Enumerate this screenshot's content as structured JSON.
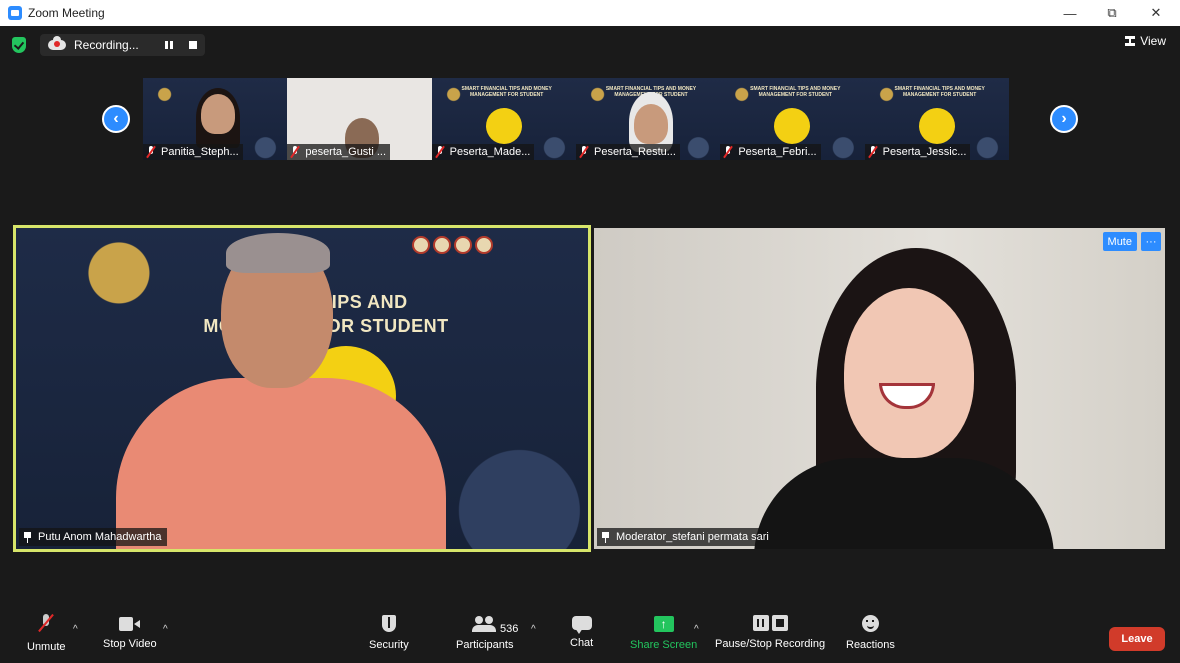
{
  "window": {
    "title": "Zoom Meeting",
    "minimize": "—",
    "restore": "⧉",
    "close": "✕"
  },
  "topbar": {
    "recording_label": "Recording...",
    "view_label": "View"
  },
  "nav": {
    "prev": "‹",
    "next": "›"
  },
  "thumbnails": [
    {
      "name": "Panitia_Steph..."
    },
    {
      "name": "peserta_Gusti ..."
    },
    {
      "name": "Peserta_Made..."
    },
    {
      "name": "Peserta_Restu..."
    },
    {
      "name": "Peserta_Febri..."
    },
    {
      "name": "Peserta_Jessic..."
    }
  ],
  "thumb_header_text": "SMART FINANCIAL TIPS AND MONEY MANAGEMENT FOR STUDENT",
  "speaker": {
    "name": "Putu Anom Mahadwartha",
    "slide_title_line1": "SMA        AL TIPS AND",
    "slide_title_line2": "MONEY M         T FOR STUDENT"
  },
  "moderator": {
    "name": "Moderator_stefani permata sari",
    "mute_label": "Mute",
    "more_label": "···"
  },
  "toolbar": {
    "unmute": "Unmute",
    "stop_video": "Stop Video",
    "security": "Security",
    "participants": "Participants",
    "participants_count": "536",
    "chat": "Chat",
    "share_screen": "Share Screen",
    "pause_stop_recording": "Pause/Stop Recording",
    "reactions": "Reactions",
    "leave": "Leave",
    "caret": "^",
    "share_arrow": "↑"
  },
  "colors": {
    "accent": "#2D8CFF",
    "share_green": "#23c55e",
    "leave_red": "#d13b2a",
    "active_speaker_border": "#d7e56a"
  }
}
